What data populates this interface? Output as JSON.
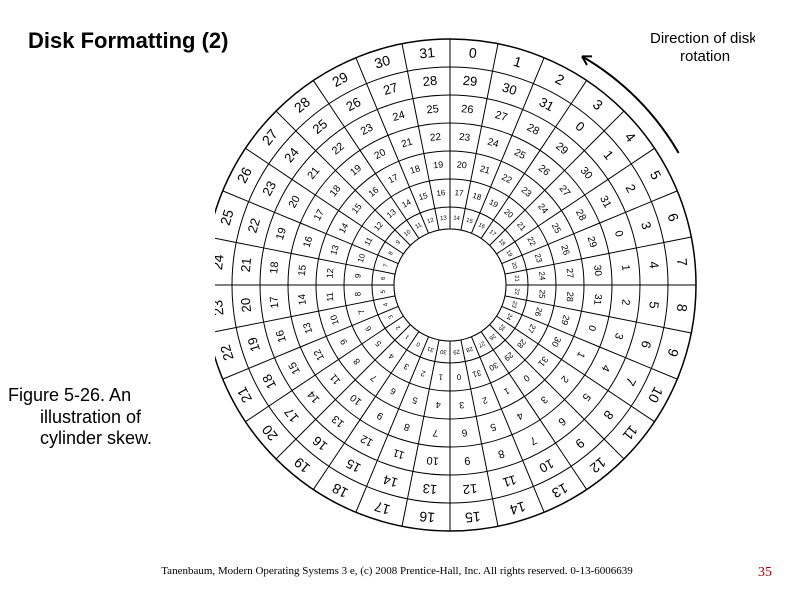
{
  "title": "Disk Formatting (2)",
  "caption": {
    "line1": "Figure 5-26. An",
    "line2": "illustration of",
    "line3": "cylinder skew."
  },
  "rotation_label": {
    "line1": "Direction of disk",
    "line2": "rotation"
  },
  "footer": "Tanenbaum, Modern Operating Systems 3 e, (c) 2008 Prentice-Hall, Inc. All rights reserved. 0-13-6006639",
  "page_number": "35",
  "disk": {
    "sectors_per_track": 32,
    "tracks": [
      {
        "outer_r": 246,
        "inner_r": 218,
        "start": 0,
        "font": 14
      },
      {
        "outer_r": 218,
        "inner_r": 190,
        "start": 29,
        "font": 13
      },
      {
        "outer_r": 190,
        "inner_r": 162,
        "start": 26,
        "font": 11
      },
      {
        "outer_r": 162,
        "inner_r": 134,
        "start": 23,
        "font": 10
      },
      {
        "outer_r": 134,
        "inner_r": 106,
        "start": 20,
        "font": 9
      },
      {
        "outer_r": 106,
        "inner_r": 78,
        "start": 17,
        "font": 8
      },
      {
        "outer_r": 78,
        "inner_r": 56,
        "start": 14,
        "font": 6
      }
    ],
    "hub_r": 56
  }
}
